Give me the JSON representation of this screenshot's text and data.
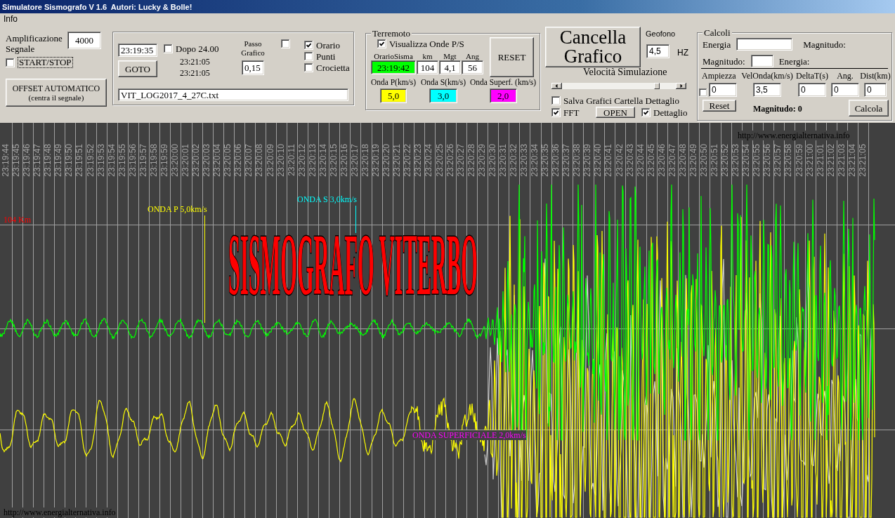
{
  "window": {
    "title": "Simulatore Sismografo V 1.6  Autori: Lucky & Bolle!"
  },
  "menu": [
    {
      "label": "Info"
    }
  ],
  "signal": {
    "amplification_label": "Amplificazione Segnale",
    "amplification_value": "4000",
    "start_stop": {
      "label": "START/STOP",
      "checked": false,
      "focused": true
    },
    "offset_button": {
      "label": "OFFSET AUTOMATICO",
      "hint": "(centra il segnale)"
    }
  },
  "playback": {
    "time_value": "23:19:35",
    "goto_button": "GOTO",
    "after_midnight": {
      "label": "Dopo 24.00",
      "checked": false
    },
    "times": [
      "23:21:05",
      "23:21:05"
    ],
    "step_label": "Passo Grafico",
    "step_value": "0,15",
    "unlabeled_checkbox": {
      "checked": false
    },
    "display_options": [
      {
        "label": "Orario",
        "checked": true
      },
      {
        "label": "Punti",
        "checked": false
      },
      {
        "label": "Crocietta",
        "checked": false
      }
    ],
    "file_value": "VIT_LOG2017_4_27C.txt"
  },
  "earthquake": {
    "title": "Terremoto",
    "show_waves": {
      "label": "Visualizza Onde P/S",
      "checked": true
    },
    "fields": [
      {
        "label": "OrarioSisma",
        "value": "23:19:42",
        "color": "#00ff00"
      },
      {
        "label": "km",
        "value": "104",
        "color": "#ffffff"
      },
      {
        "label": "Mgt",
        "value": "4,1",
        "color": "#ffffff"
      },
      {
        "label": "Ang",
        "value": "56",
        "color": "#ffffff"
      }
    ],
    "reset_button": "RESET",
    "wave_speeds": [
      {
        "label": "Onda P(km/s)",
        "value": "5,0",
        "color": "#ffff00"
      },
      {
        "label": "Onda S(km/s)",
        "value": "3,0",
        "color": "#00ffff"
      },
      {
        "label": "Onda Superf. (km/s)",
        "value": "2,0",
        "color": "#ff00ff"
      }
    ]
  },
  "clear_button": "Cancella Grafico",
  "geophone": {
    "label": "Geofono",
    "value": "4,5",
    "unit": "HZ"
  },
  "speed": {
    "label": "Velocità Simulazione",
    "level": 0.85
  },
  "save_charts": {
    "label": "Salva Grafici Cartella Dettaglio",
    "checked": false
  },
  "fft": {
    "label": "FFT",
    "checked": true
  },
  "open_button": "OPEN",
  "detail": {
    "label": "Dettaglio",
    "checked": true
  },
  "calculations": {
    "title": "Calcoli",
    "energy_label": "Energia",
    "magnitude_out_label": "Magnitudo:",
    "magnitude_label": "Magnitudo:",
    "energy_out_label": "Energia:",
    "amplitude_checkbox": {
      "checked": false
    },
    "columns": [
      {
        "label": "Ampiezza",
        "value": "0"
      },
      {
        "label": "VelOnda(km/s)",
        "value": "3,5"
      },
      {
        "label": "DeltaT(s)",
        "value": "0"
      },
      {
        "label": "Ang.",
        "value": "0"
      },
      {
        "label": "Dist(km)",
        "value": "0"
      }
    ],
    "reset_button": "Reset",
    "result": "Magnitudo: 0",
    "calc_button": "Calcola"
  },
  "chart": {
    "time_labels": [
      "23:19:44",
      "23:19:45",
      "23:19:46",
      "23:19:47",
      "23:19:48",
      "23:19:49",
      "23:19:50",
      "23:19:51",
      "23:19:52",
      "23:19:53",
      "23:19:54",
      "23:19:55",
      "23:19:56",
      "23:19:57",
      "23:19:58",
      "23:19:59",
      "23:20:00",
      "23:20:01",
      "23:20:02",
      "23:20:03",
      "23:20:04",
      "23:20:05",
      "23:20:06",
      "23:20:07",
      "23:20:08",
      "23:20:09",
      "23:20:10",
      "23:20:11",
      "23:20:12",
      "23:20:13",
      "23:20:14",
      "23:20:15",
      "23:20:16",
      "23:20:17",
      "23:20:18",
      "23:20:19",
      "23:20:20",
      "23:20:21",
      "23:20:22",
      "23:20:23",
      "23:20:24",
      "23:20:25",
      "23:20:26",
      "23:20:27",
      "23:20:28",
      "23:20:29",
      "23:20:30",
      "23:20:31",
      "23:20:32",
      "23:20:33",
      "23:20:34",
      "23:20:35",
      "23:20:36",
      "23:20:37",
      "23:20:38",
      "23:20:39",
      "23:20:40",
      "23:20:41",
      "23:20:42",
      "23:20:43",
      "23:20:44",
      "23:20:45",
      "23:20:46",
      "23:20:47",
      "23:20:48",
      "23:20:49",
      "23:20:50",
      "23:20:51",
      "23:20:52",
      "23:20:53",
      "23:20:54",
      "23:20:55",
      "23:20:56",
      "23:20:57",
      "23:20:58",
      "23:20:59",
      "23:21:00",
      "23:21:01",
      "23:21:02",
      "23:21:03",
      "23:21:04",
      "23:21:05"
    ],
    "credit_top": "http://www.energialternativa.info",
    "distance_label": "104 Km",
    "wave_markers": [
      {
        "kind": "s",
        "label": "ONDA S 3,0km/s",
        "color": "#00ffff"
      },
      {
        "kind": "p",
        "label": "ONDA P 5,0km/s",
        "color": "#ffff00"
      },
      {
        "kind": "surface",
        "label": "ONDA SUPERFICIALE 2,0km/s",
        "color": "#ff00ff"
      }
    ],
    "title": "SISMOGRAFO VITERBO",
    "credit_bottom": "http://www.energialternativa.info"
  }
}
